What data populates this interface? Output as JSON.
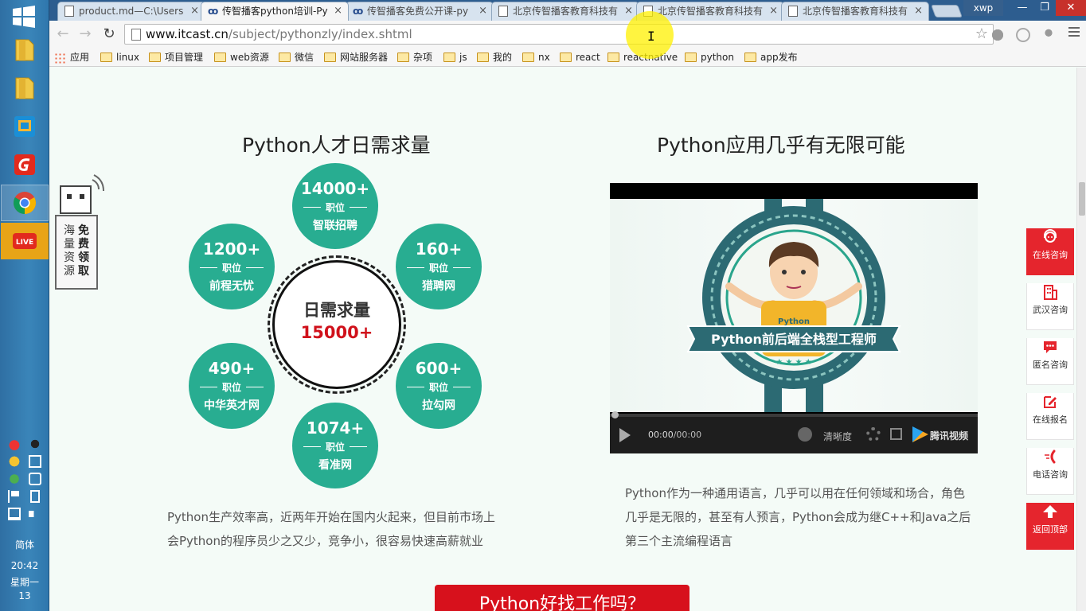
{
  "taskbar": {
    "ime": "简体",
    "time": "20:42",
    "weekday": "星期一",
    "date": "13"
  },
  "tabs": [
    {
      "label": "product.md—C:\\Users",
      "icon": "document-icon"
    },
    {
      "label": "传智播客python培训-Py",
      "icon": "itcast-icon"
    },
    {
      "label": "传智播客免费公开课-py",
      "icon": "itcast-icon"
    },
    {
      "label": "北京传智播客教育科技有",
      "icon": "document-icon"
    },
    {
      "label": "北京传智播客教育科技有",
      "icon": "document-icon"
    },
    {
      "label": "北京传智播客教育科技有",
      "icon": "document-icon"
    }
  ],
  "profile": "xwp",
  "address": {
    "domain": "www.itcast.cn",
    "path": "/subject/pythonzly/index.shtml"
  },
  "bookmarks": [
    {
      "label": "应用",
      "icon": "apps-icon"
    },
    {
      "label": "linux",
      "icon": "folder-icon"
    },
    {
      "label": "项目管理",
      "icon": "folder-icon"
    },
    {
      "label": "web资源",
      "icon": "folder-icon"
    },
    {
      "label": "微信",
      "icon": "folder-icon"
    },
    {
      "label": "网站服务器",
      "icon": "folder-icon"
    },
    {
      "label": "杂项",
      "icon": "folder-icon"
    },
    {
      "label": "js",
      "icon": "folder-icon"
    },
    {
      "label": "我的",
      "icon": "folder-icon"
    },
    {
      "label": "nx",
      "icon": "folder-icon"
    },
    {
      "label": "react",
      "icon": "folder-icon"
    },
    {
      "label": "reactnative",
      "icon": "folder-icon"
    },
    {
      "label": "python",
      "icon": "folder-icon"
    },
    {
      "label": "app发布",
      "icon": "folder-icon"
    }
  ],
  "left_section": {
    "title": "Python人才日需求量",
    "center_label": "日需求量",
    "center_value": "15000+",
    "position_label": "职位",
    "demands": [
      {
        "count": "14000+",
        "site": "智联招聘"
      },
      {
        "count": "160+",
        "site": "猎聘网"
      },
      {
        "count": "600+",
        "site": "拉勾网"
      },
      {
        "count": "1074+",
        "site": "看准网"
      },
      {
        "count": "490+",
        "site": "中华英才网"
      },
      {
        "count": "1200+",
        "site": "前程无忧"
      }
    ],
    "paragraph_line1": "Python生产效率高，近两年开始在国内火起来，但目前市场上",
    "paragraph_line2": "会Python的程序员少之又少，竞争小，很容易快速高薪就业"
  },
  "right_section": {
    "title": "Python应用几乎有无限可能",
    "video": {
      "shirt_text": "Python",
      "banner_text": "Python前后端全栈型工程师",
      "time_current": "00:00",
      "time_total": "/00:00",
      "quality": "清晰度",
      "brand": "腾讯视频"
    },
    "paragraph_line1": "Python作为一种通用语言，几乎可以用在任何领域和场合，角色",
    "paragraph_line2": "几乎是无限的，甚至有人预言，Python会成为继C++和Java之后",
    "paragraph_line3": "第三个主流编程语言"
  },
  "free_box": {
    "col1": [
      "海",
      "量",
      "资",
      "源"
    ],
    "col2": [
      "免",
      "费",
      "领",
      "取"
    ]
  },
  "float_menu": [
    {
      "label": "在线咨询",
      "icon": "support-agent-icon",
      "red": true
    },
    {
      "label": "武汉咨询",
      "icon": "building-icon",
      "red": false
    },
    {
      "label": "匿名咨询",
      "icon": "chat-bubble-icon",
      "red": false
    },
    {
      "label": "在线报名",
      "icon": "edit-icon",
      "red": false
    },
    {
      "label": "电话咨询",
      "icon": "phone-icon",
      "red": false
    },
    {
      "label": "返回顶部",
      "icon": "arrow-up-icon",
      "red": true
    }
  ],
  "cta": "Python好找工作吗？",
  "colors": {
    "accent_green": "#28ad91",
    "accent_red": "#e5252d",
    "demand_red": "#d0111b"
  }
}
